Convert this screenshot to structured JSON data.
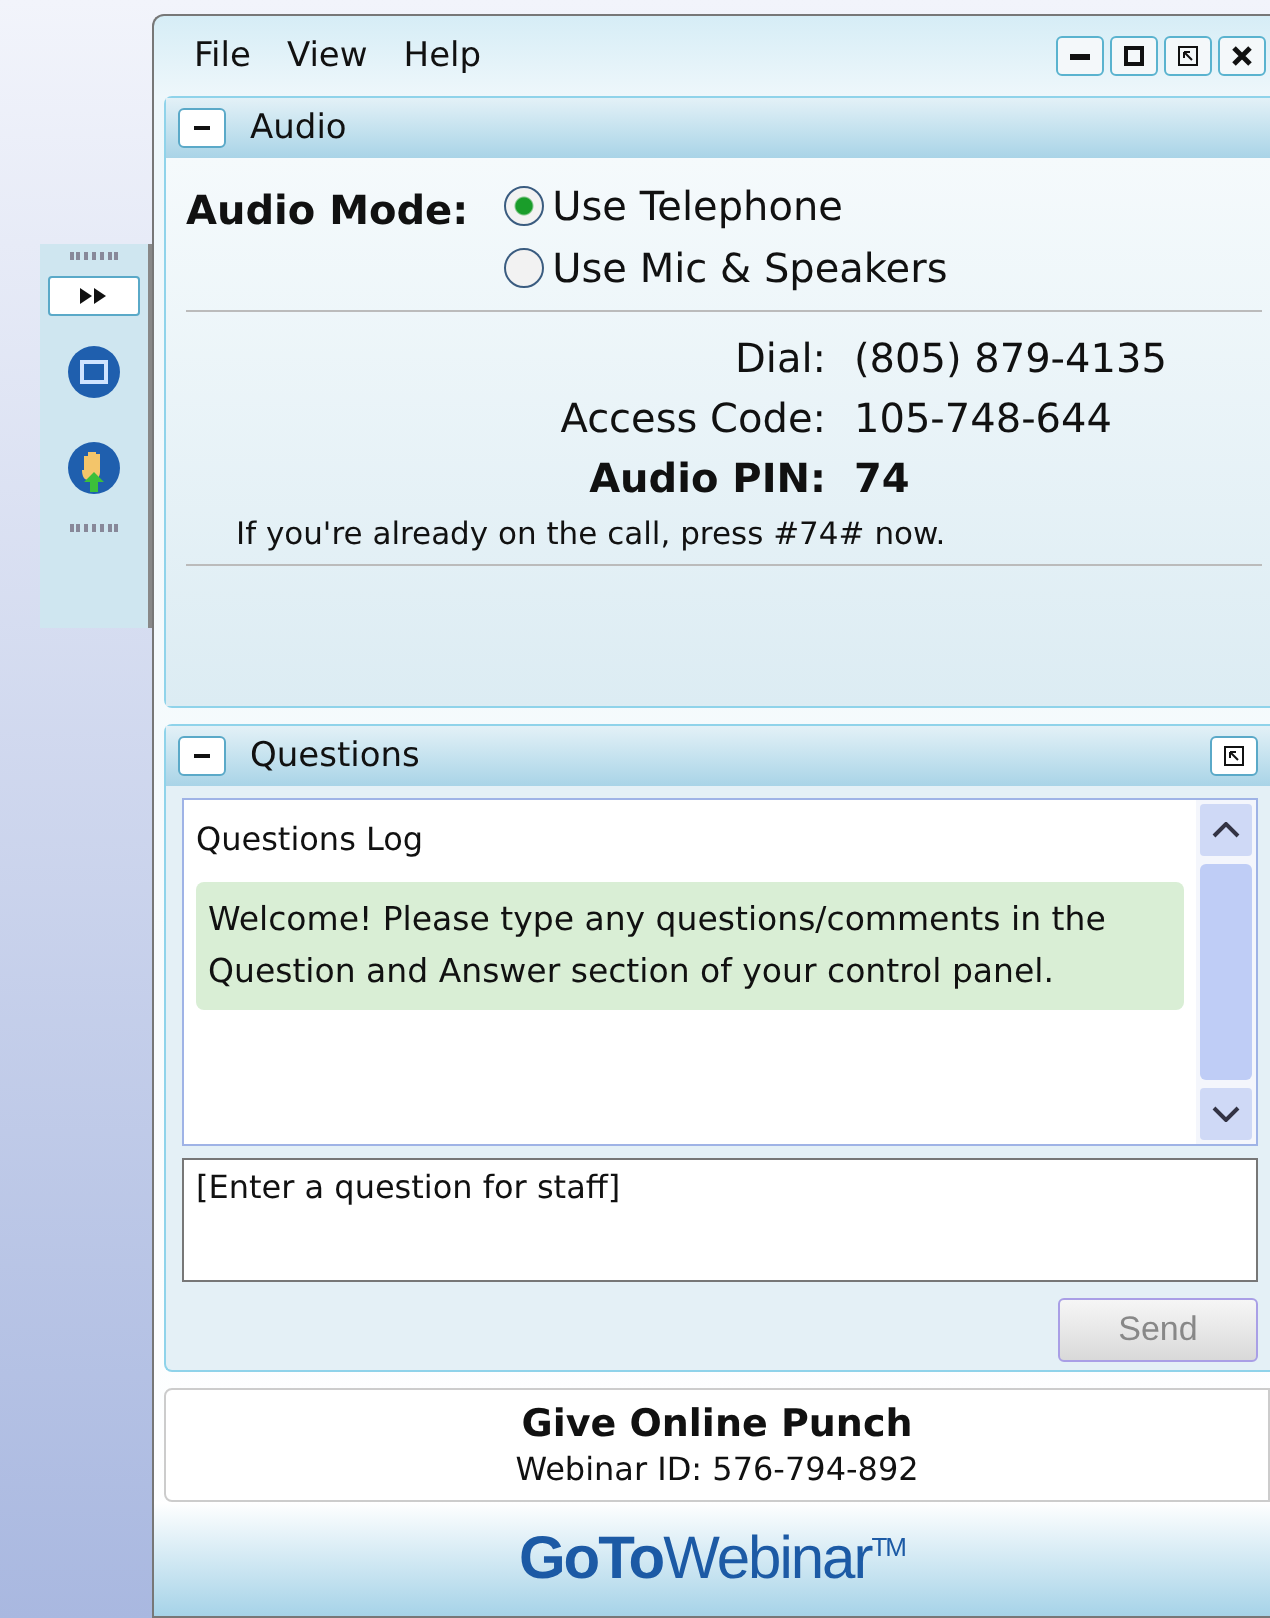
{
  "menu": [
    "File",
    "View",
    "Help"
  ],
  "audio": {
    "title": "Audio",
    "expanded": true,
    "mode_label": "Audio Mode:",
    "options": [
      {
        "label": "Use Telephone",
        "selected": true
      },
      {
        "label": "Use Mic & Speakers",
        "selected": false
      }
    ],
    "dial_label": "Dial:",
    "dial": "(805) 879-4135",
    "code_label": "Access Code:",
    "code": "105-748-644",
    "pin_label": "Audio PIN:",
    "pin": "74",
    "note": "If you're already on the call, press #74# now."
  },
  "questions": {
    "title": "Questions",
    "expanded": true,
    "log_title": "Questions Log",
    "welcome": "Welcome! Please type any questions/comments in the Question and Answer section of your control panel.",
    "placeholder": "[Enter a question for staff]",
    "send": "Send",
    "send_disabled": true
  },
  "webinar": {
    "title": "Give Online Punch",
    "id": "Webinar ID: 576-794-892"
  },
  "logo": "**GoTo**Webinar$^{TM}$"
}
